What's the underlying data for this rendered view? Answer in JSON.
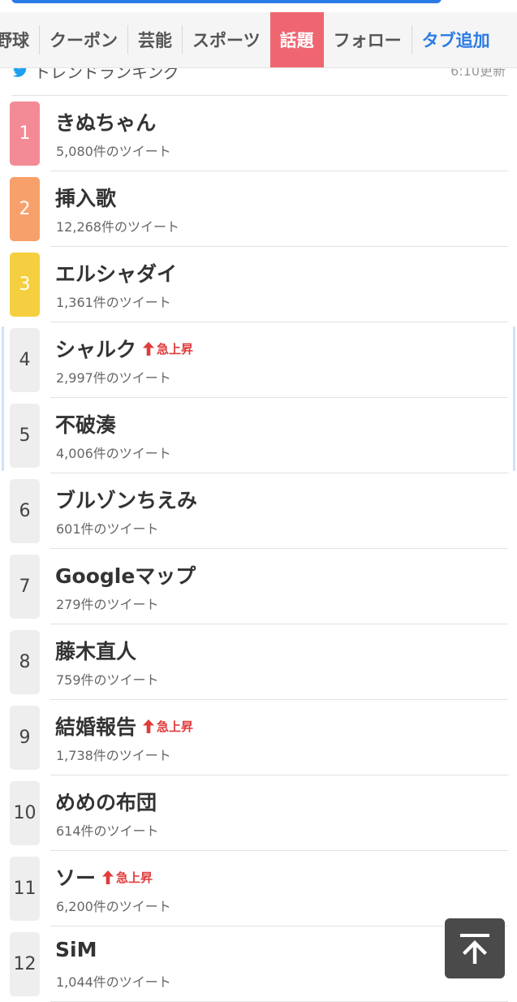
{
  "tabs": [
    {
      "label": "野球",
      "active": false
    },
    {
      "label": "クーポン",
      "active": false
    },
    {
      "label": "芸能",
      "active": false
    },
    {
      "label": "スポーツ",
      "active": false
    },
    {
      "label": "話題",
      "active": true
    },
    {
      "label": "フォロー",
      "active": false
    }
  ],
  "add_tab_label": "タブ追加",
  "section": {
    "title": "トレンドランキング",
    "updated": "6:10更新",
    "icon": "twitter-bird-icon"
  },
  "surge_label": "急上昇",
  "colors": {
    "accent_red": "#ef6671",
    "link_blue": "#2b7be4",
    "rank1": "#f28b96",
    "rank2": "#f8a06c",
    "rank3": "#f5cf3f",
    "surge_red": "#e03c3c"
  },
  "ranking": [
    {
      "rank": "1",
      "term": "きぬちゃん",
      "count": "5,080件のツイート",
      "surge": false
    },
    {
      "rank": "2",
      "term": "挿入歌",
      "count": "12,268件のツイート",
      "surge": false
    },
    {
      "rank": "3",
      "term": "エルシャダイ",
      "count": "1,361件のツイート",
      "surge": false
    },
    {
      "rank": "4",
      "term": "シャルク",
      "count": "2,997件のツイート",
      "surge": true
    },
    {
      "rank": "5",
      "term": "不破湊",
      "count": "4,006件のツイート",
      "surge": false
    },
    {
      "rank": "6",
      "term": "ブルゾンちえみ",
      "count": "601件のツイート",
      "surge": false
    },
    {
      "rank": "7",
      "term": "Googleマップ",
      "count": "279件のツイート",
      "surge": false
    },
    {
      "rank": "8",
      "term": "藤木直人",
      "count": "759件のツイート",
      "surge": false
    },
    {
      "rank": "9",
      "term": "結婚報告",
      "count": "1,738件のツイート",
      "surge": true
    },
    {
      "rank": "10",
      "term": "めめの布団",
      "count": "614件のツイート",
      "surge": false
    },
    {
      "rank": "11",
      "term": "ソー",
      "count": "6,200件のツイート",
      "surge": true
    },
    {
      "rank": "12",
      "term": "SiM",
      "count": "1,044件のツイート",
      "surge": false
    }
  ],
  "scroll_top_icon": "arrow-up-to-top-icon"
}
